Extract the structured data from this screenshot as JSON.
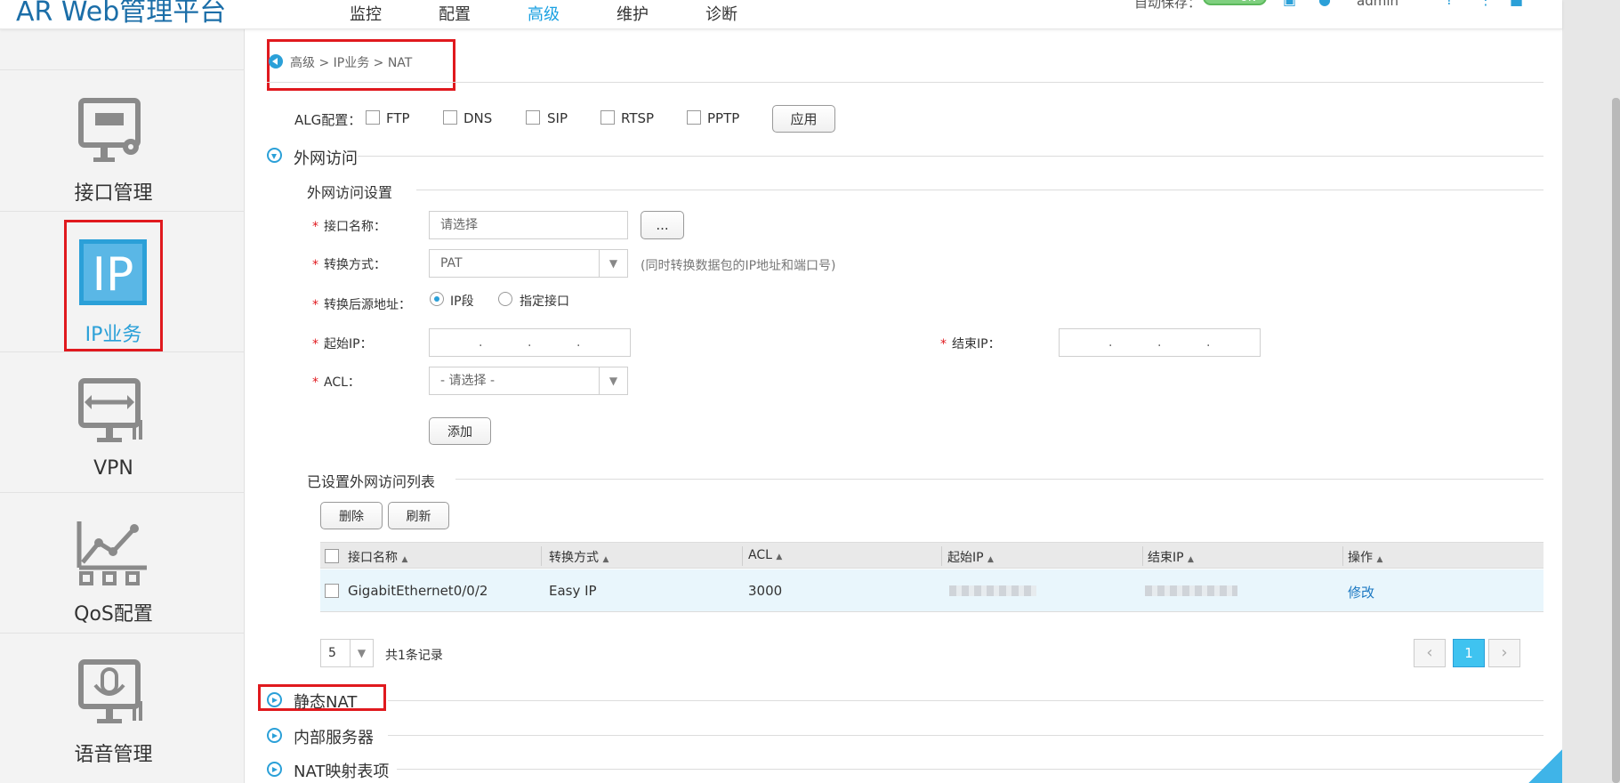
{
  "header": {
    "brand": "AR Web管理平台",
    "nav": [
      "监控",
      "配置",
      "高级",
      "维护",
      "诊断"
    ],
    "active_nav": "高级",
    "auto_save_label": "自动保存：",
    "auto_save_toggle": "ON",
    "user": "admin"
  },
  "sidebar": {
    "items": [
      {
        "label": "接口管理",
        "icon": "interface-icon"
      },
      {
        "label": "IP业务",
        "icon": "ip-icon"
      },
      {
        "label": "VPN",
        "icon": "vpn-icon"
      },
      {
        "label": "QoS配置",
        "icon": "qos-icon"
      },
      {
        "label": "语音管理",
        "icon": "voice-icon"
      }
    ],
    "active": "IP业务"
  },
  "breadcrumb": "高级 > IP业务 > NAT",
  "alg": {
    "label": "ALG配置：",
    "options": [
      "FTP",
      "DNS",
      "SIP",
      "RTSP",
      "PPTP"
    ],
    "apply": "应用"
  },
  "sections": {
    "outbound": "外网访问",
    "static_nat": "静态NAT",
    "internal_server": "内部服务器",
    "nat_mapping": "NAT映射表项"
  },
  "form": {
    "title": "外网访问设置",
    "interface_label": "接口名称：",
    "interface_placeholder": "请选择",
    "browse_button": "...",
    "mode_label": "转换方式：",
    "mode_value": "PAT",
    "mode_hint": "(同时转换数据包的IP地址和端口号)",
    "source_label": "转换后源地址：",
    "source_opt1": "IP段",
    "source_opt2": "指定接口",
    "start_ip_label": "起始IP：",
    "end_ip_label": "结束IP：",
    "acl_label": "ACL：",
    "acl_value": "- 请选择 -",
    "add_button": "添加"
  },
  "list": {
    "title": "已设置外网访问列表",
    "delete_button": "删除",
    "refresh_button": "刷新",
    "columns": [
      "接口名称",
      "转换方式",
      "ACL",
      "起始IP",
      "结束IP",
      "操作"
    ],
    "rows": [
      {
        "interface": "GigabitEthernet0/0/2",
        "mode": "Easy IP",
        "acl": "3000",
        "action": "修改"
      }
    ],
    "page_size": "5",
    "total": "共1条记录",
    "current_page": "1"
  }
}
